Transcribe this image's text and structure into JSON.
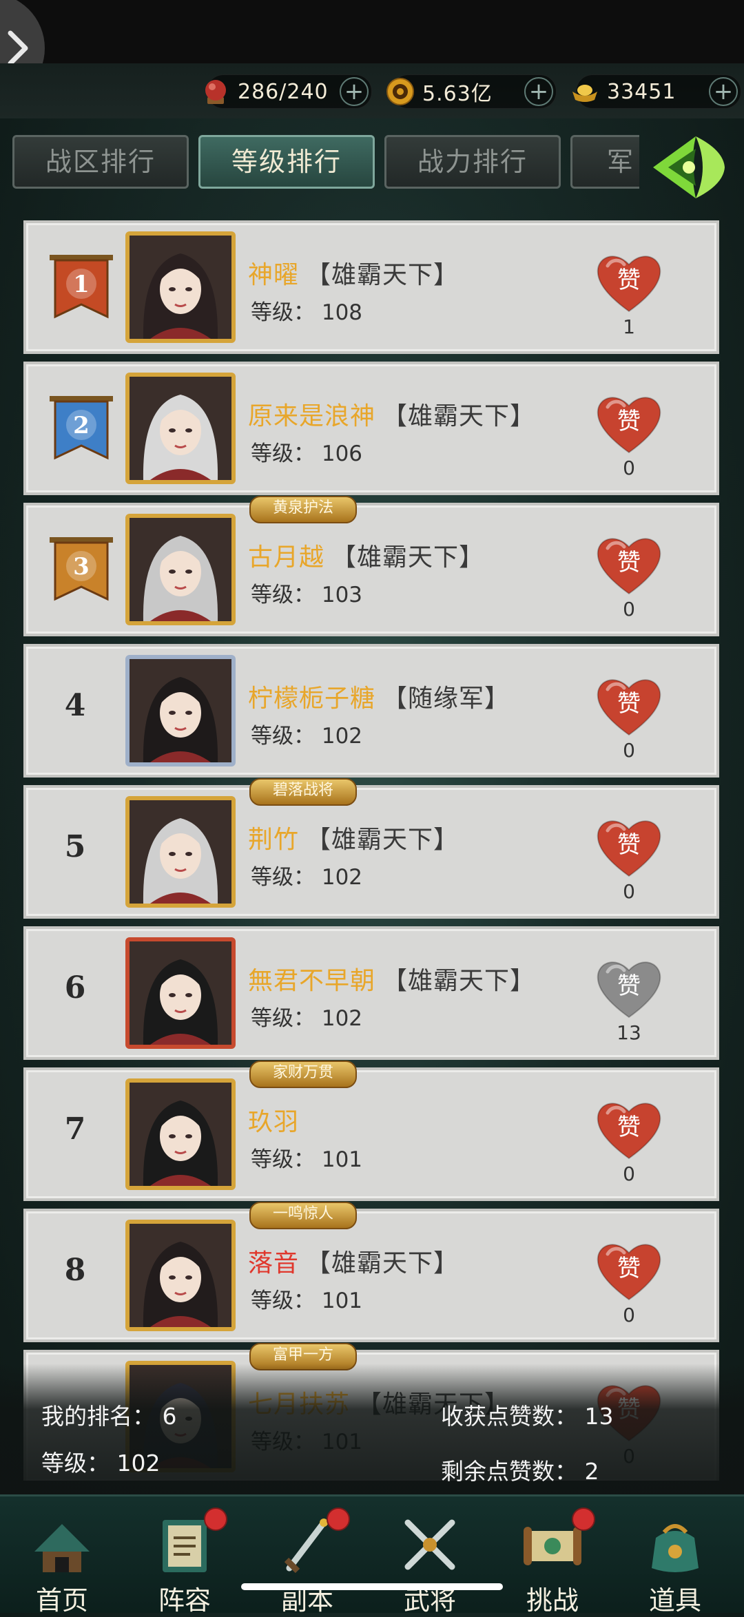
{
  "resources": [
    {
      "icon": "red-orb-icon",
      "value": "286/240",
      "color": "#b8322a"
    },
    {
      "icon": "gold-coin-icon",
      "value": "5.63亿",
      "color": "#d79a1e"
    },
    {
      "icon": "gold-ingot-icon",
      "value": "33451",
      "color": "#e2b53a"
    }
  ],
  "tabs": [
    {
      "label": "战区排行",
      "active": false
    },
    {
      "label": "等级排行",
      "active": true
    },
    {
      "label": "战力排行",
      "active": false
    },
    {
      "label": "军",
      "active": false
    }
  ],
  "like_label": "赞",
  "level_label": "等级：",
  "rankings": [
    {
      "rank": "1",
      "name": "神曜",
      "guild": "【雄霸天下】",
      "level": "108",
      "likes": "1",
      "title": "",
      "liked": false
    },
    {
      "rank": "2",
      "name": "原来是浪神",
      "guild": "【雄霸天下】",
      "level": "106",
      "likes": "0",
      "title": "",
      "liked": false
    },
    {
      "rank": "3",
      "name": "古月越",
      "guild": "【雄霸天下】",
      "level": "103",
      "likes": "0",
      "title": "黄泉护法",
      "liked": false
    },
    {
      "rank": "4",
      "name": "柠檬栀子糖",
      "guild": "【随缘军】",
      "level": "102",
      "likes": "0",
      "title": "",
      "liked": false
    },
    {
      "rank": "5",
      "name": "荆竹",
      "guild": "【雄霸天下】",
      "level": "102",
      "likes": "0",
      "title": "碧落战将",
      "liked": false
    },
    {
      "rank": "6",
      "name": "無君不早朝",
      "guild": "【雄霸天下】",
      "level": "102",
      "likes": "13",
      "title": "",
      "liked": true
    },
    {
      "rank": "7",
      "name": "玖羽",
      "guild": "",
      "level": "101",
      "likes": "0",
      "title": "家财万贯",
      "liked": false
    },
    {
      "rank": "8",
      "name": "落音",
      "guild": "【雄霸天下】",
      "level": "101",
      "likes": "0",
      "title": "一鸣惊人",
      "liked": false
    },
    {
      "rank": "",
      "name": "七月扶苏",
      "guild": "【雄霸天下】",
      "level": "101",
      "likes": "0",
      "title": "富甲一方",
      "liked": false
    }
  ],
  "my_info": {
    "rank_label": "我的排名：",
    "rank_value": "6",
    "level_label": "等级：",
    "level_value": "102",
    "received_label": "收获点赞数：",
    "received_value": "13",
    "remaining_label": "剩余点赞数：",
    "remaining_value": "2"
  },
  "nav": [
    {
      "label": "首页",
      "icon": "home-pavilion-icon",
      "badge": false
    },
    {
      "label": "阵容",
      "icon": "lineup-book-icon",
      "badge": true
    },
    {
      "label": "副本",
      "icon": "dungeon-sword-icon",
      "badge": true
    },
    {
      "label": "武将",
      "icon": "crossed-swords-icon",
      "badge": false
    },
    {
      "label": "挑战",
      "icon": "challenge-scroll-icon",
      "badge": true
    },
    {
      "label": "道具",
      "icon": "item-bag-icon",
      "badge": false
    }
  ]
}
